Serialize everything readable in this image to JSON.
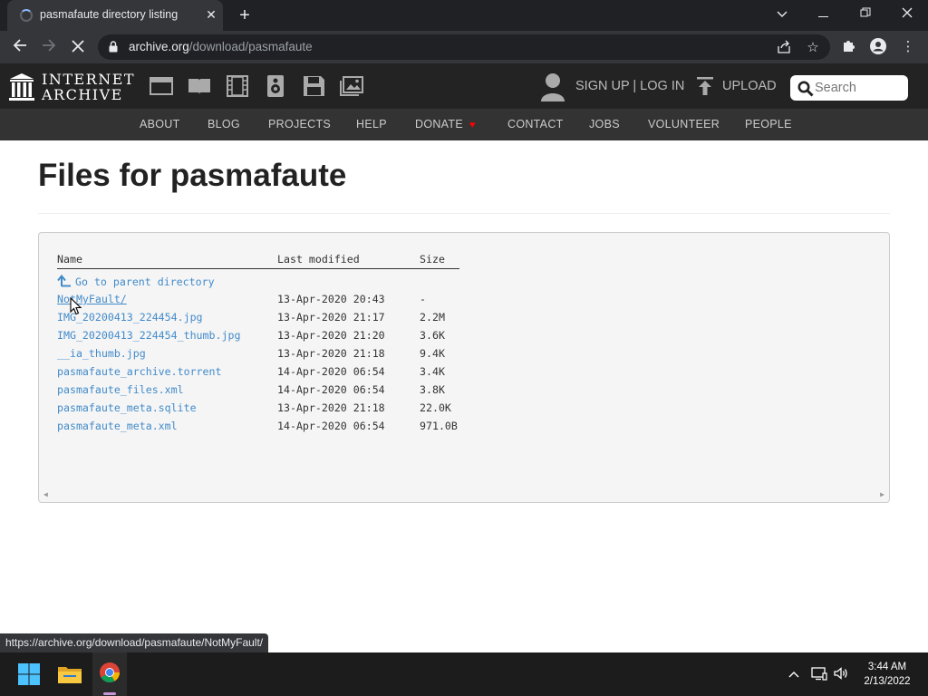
{
  "browser": {
    "tab_title": "pasmafaute directory listing",
    "url_host": "archive.org",
    "url_path": "/download/pasmafaute",
    "status_url": "https://archive.org/download/pasmafaute/NotMyFault/"
  },
  "ia": {
    "logo_line1": "INTERNET",
    "logo_line2": "ARCHIVE",
    "signup": "SIGN UP | LOG IN",
    "upload": "UPLOAD",
    "search_placeholder": "Search",
    "nav": [
      "ABOUT",
      "BLOG",
      "PROJECTS",
      "HELP",
      "DONATE",
      "CONTACT",
      "JOBS",
      "VOLUNTEER",
      "PEOPLE"
    ]
  },
  "page": {
    "title": "Files for pasmafaute",
    "headers": {
      "name": "Name",
      "modified": "Last modified",
      "size": "Size"
    },
    "parent_link": "Go to parent directory",
    "files": [
      {
        "name": "NotMyFault/",
        "modified": "13-Apr-2020 20:43",
        "size": "-"
      },
      {
        "name": "IMG_20200413_224454.jpg",
        "modified": "13-Apr-2020 21:17",
        "size": "2.2M"
      },
      {
        "name": "IMG_20200413_224454_thumb.jpg",
        "modified": "13-Apr-2020 21:20",
        "size": "3.6K"
      },
      {
        "name": "__ia_thumb.jpg",
        "modified": "13-Apr-2020 21:18",
        "size": "9.4K"
      },
      {
        "name": "pasmafaute_archive.torrent",
        "modified": "14-Apr-2020 06:54",
        "size": "3.4K"
      },
      {
        "name": "pasmafaute_files.xml",
        "modified": "14-Apr-2020 06:54",
        "size": "3.8K"
      },
      {
        "name": "pasmafaute_meta.sqlite",
        "modified": "13-Apr-2020 21:18",
        "size": "22.0K"
      },
      {
        "name": "pasmafaute_meta.xml",
        "modified": "14-Apr-2020 06:54",
        "size": "971.0B"
      }
    ]
  },
  "taskbar": {
    "time": "3:44 AM",
    "date": "2/13/2022"
  },
  "colors": {
    "link": "#428bca",
    "ia_header": "#232323",
    "ia_nav": "#333333",
    "donate_heart": "#ff0000"
  }
}
